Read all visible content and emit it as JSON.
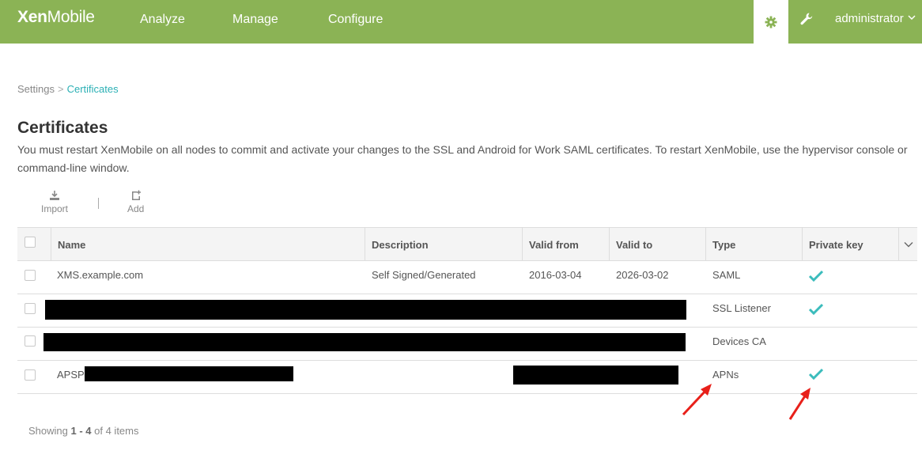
{
  "brand": {
    "bold": "Xen",
    "light": "Mobile"
  },
  "nav": [
    {
      "label": "Analyze"
    },
    {
      "label": "Manage"
    },
    {
      "label": "Configure"
    }
  ],
  "user": {
    "name": "administrator"
  },
  "icons": {
    "settings": "gear-icon",
    "support": "wrench-icon",
    "menu": "chevron-down-icon"
  },
  "colors": {
    "topbar": "#8bb355",
    "accent": "#2bb0b5",
    "check": "#3bbcbc",
    "annotation_arrow": "#e8201a"
  },
  "breadcrumb": {
    "parent": "Settings",
    "separator": ">",
    "current": "Certificates"
  },
  "page": {
    "title": "Certificates",
    "description": "You must restart XenMobile on all nodes to commit and activate your changes to the SSL and Android for Work SAML certificates. To restart XenMobile, use the hypervisor console or command-line window."
  },
  "toolbar": {
    "import_label": "Import",
    "add_label": "Add"
  },
  "table": {
    "columns": [
      "Name",
      "Description",
      "Valid from",
      "Valid to",
      "Type",
      "Private key"
    ],
    "rows": [
      {
        "name": "XMS.example.com",
        "description": "Self Signed/Generated",
        "valid_from": "2016-03-04",
        "valid_to": "2026-03-02",
        "type": "SAML",
        "private_key": true
      },
      {
        "name": "[redacted]",
        "description": "[redacted]",
        "valid_from": "[redacted]",
        "valid_to": "[redacted]",
        "type": "SSL Listener",
        "private_key": true
      },
      {
        "name": "[redacted]",
        "description": "[redacted]",
        "valid_from": "[redacted]",
        "valid_to": "[redacted]",
        "type": "Devices CA",
        "private_key": false
      },
      {
        "name": "APSP:",
        "description": "[redacted]",
        "valid_from": "[redacted]",
        "valid_to": "[redacted]",
        "type": "APNs",
        "private_key": true
      }
    ]
  },
  "footer": {
    "prefix": "Showing",
    "range": "1 - 4",
    "suffix": "of 4 items"
  }
}
